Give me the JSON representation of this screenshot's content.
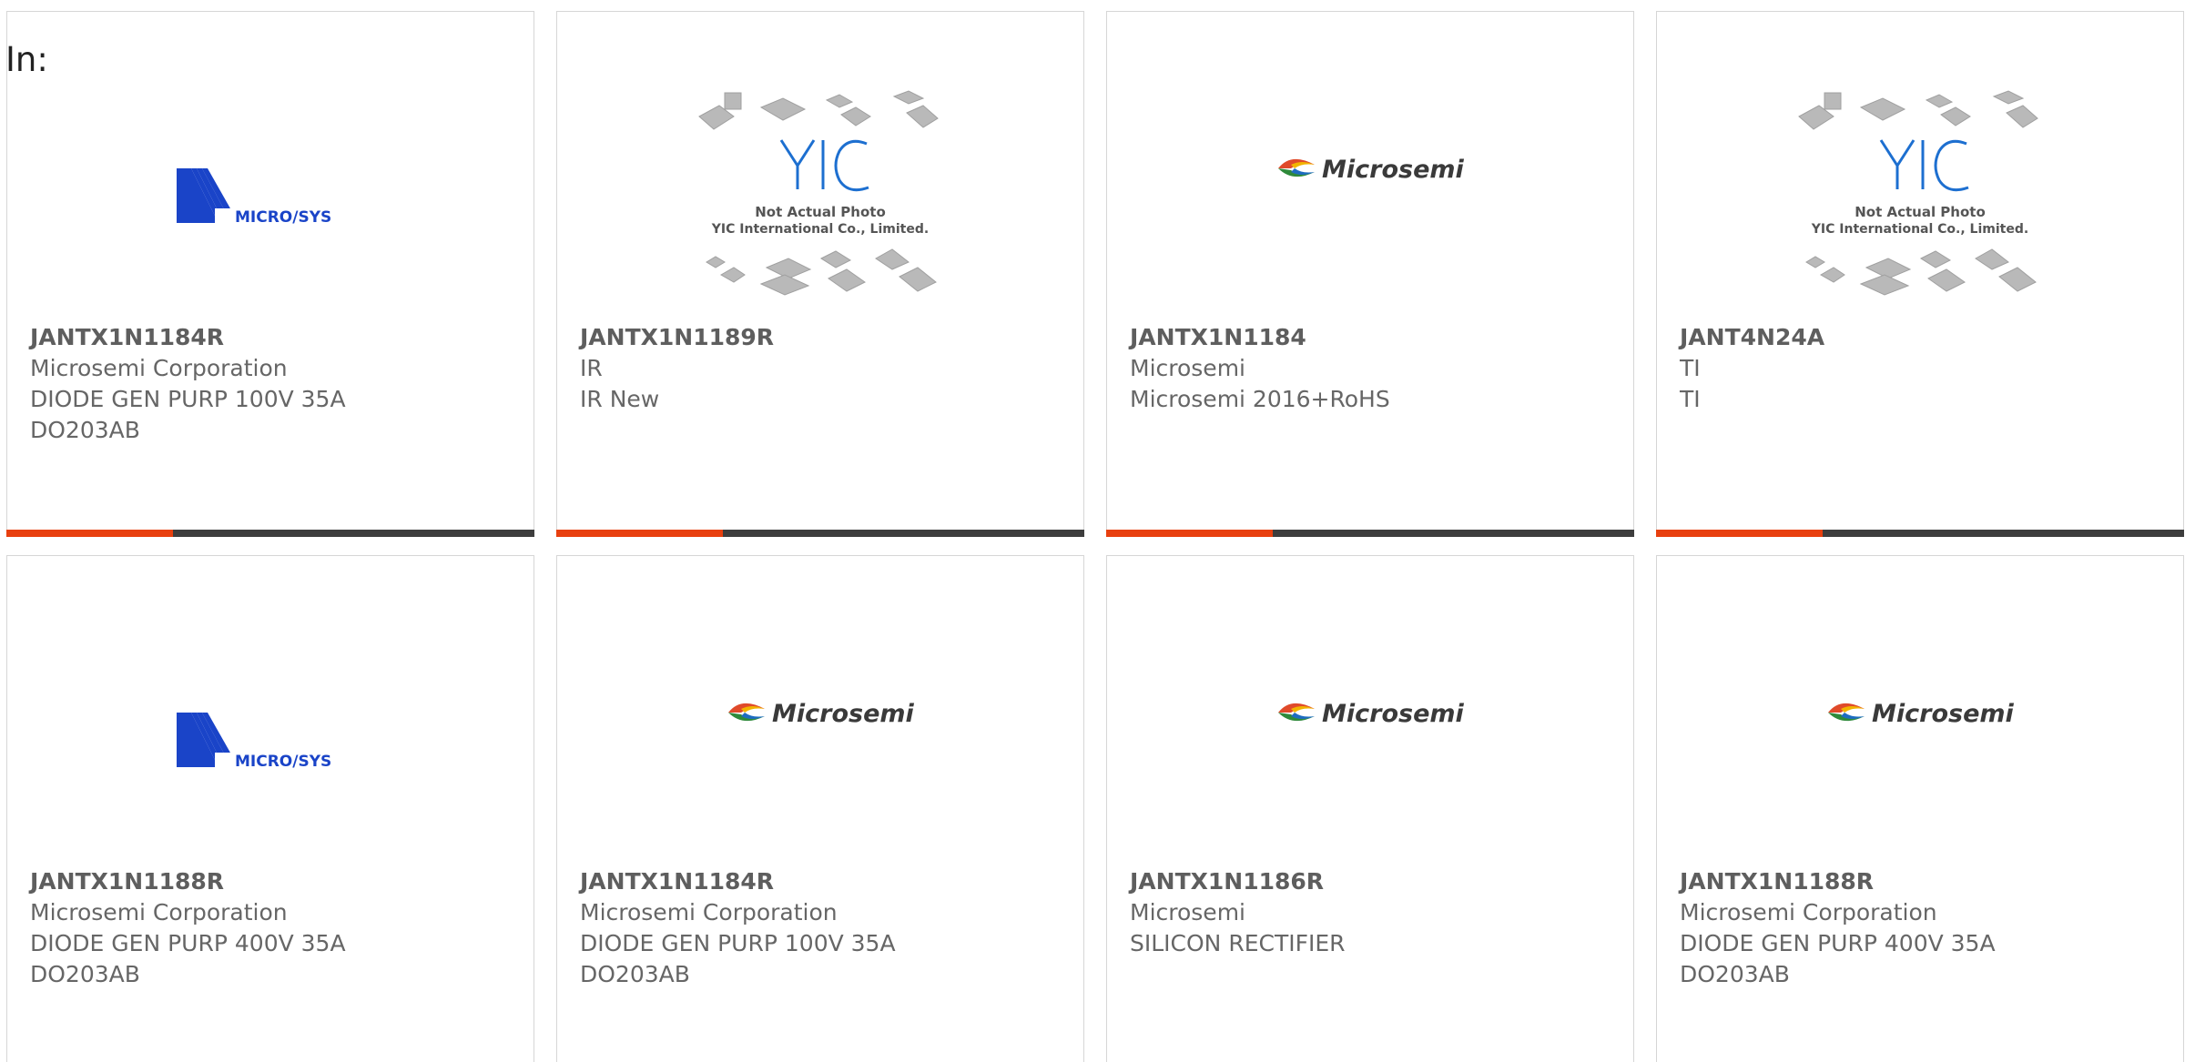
{
  "header": {
    "label": "In:"
  },
  "colors": {
    "accent": "#e8400f",
    "bar": "#3d3d3d",
    "microsys_blue": "#1a44c8",
    "yic_blue": "#1d6fd0"
  },
  "cards": [
    {
      "part": "JANTX1N1184R",
      "lines": [
        "Microsemi Corporation",
        "DIODE GEN PURP 100V 35A",
        "DO203AB"
      ],
      "logo": "microsys-logo"
    },
    {
      "part": "JANTX1N1189R",
      "lines": [
        "IR",
        "IR New",
        ""
      ],
      "logo": "yic-placeholder",
      "photo_note": [
        "Not Actual Photo",
        "YIC International Co., Limited."
      ]
    },
    {
      "part": "JANTX1N1184",
      "lines": [
        "Microsemi",
        "Microsemi 2016+RoHS",
        ""
      ],
      "logo": "microsemi-logo",
      "brand": "Microsemi"
    },
    {
      "part": "JANT4N24A",
      "lines": [
        "TI",
        "TI",
        ""
      ],
      "logo": "yic-placeholder",
      "photo_note": [
        "Not Actual Photo",
        "YIC International Co., Limited."
      ]
    },
    {
      "part": "JANTX1N1188R",
      "lines": [
        "Microsemi Corporation",
        "DIODE GEN PURP 400V 35A",
        "DO203AB"
      ],
      "logo": "microsys-logo"
    },
    {
      "part": "JANTX1N1184R",
      "lines": [
        "Microsemi Corporation",
        "DIODE GEN PURP 100V 35A",
        "DO203AB"
      ],
      "logo": "microsemi-logo",
      "brand": "Microsemi"
    },
    {
      "part": "JANTX1N1186R",
      "lines": [
        "Microsemi",
        "SILICON RECTIFIER",
        ""
      ],
      "logo": "microsemi-logo",
      "brand": "Microsemi"
    },
    {
      "part": "JANTX1N1188R",
      "lines": [
        "Microsemi Corporation",
        "DIODE GEN PURP 400V 35A",
        "DO203AB"
      ],
      "logo": "microsemi-logo",
      "brand": "Microsemi"
    }
  ]
}
